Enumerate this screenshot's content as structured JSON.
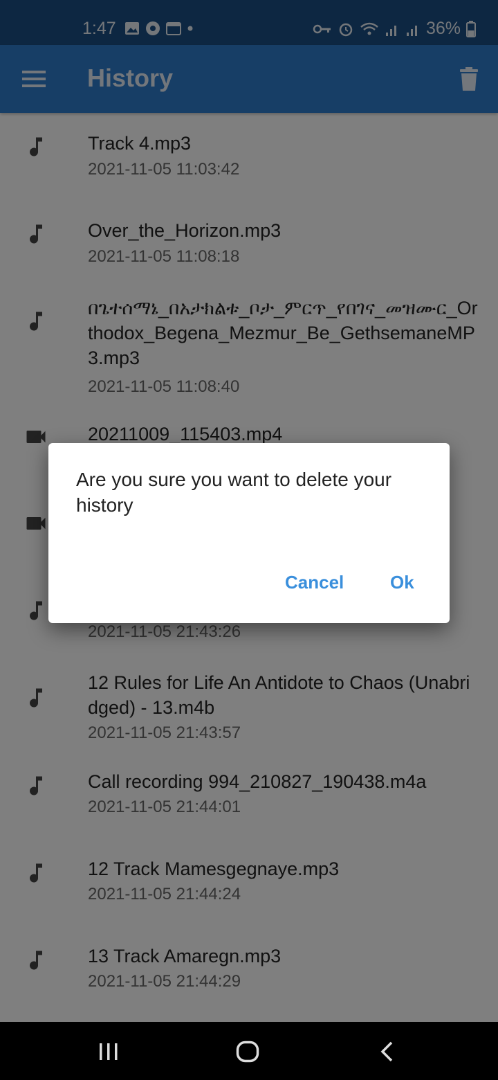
{
  "status_bar": {
    "time": "1:47",
    "battery": "36%"
  },
  "app_bar": {
    "title": "History",
    "menu_icon": "hamburger-menu-icon",
    "delete_icon": "trash-icon"
  },
  "history": [
    {
      "icon": "music-note-icon",
      "title": "Track 4.mp3",
      "date": "2021-11-05 11:03:42"
    },
    {
      "icon": "music-note-icon",
      "title": "Over_the_Horizon.mp3",
      "date": "2021-11-05 11:08:18"
    },
    {
      "icon": "music-note-icon",
      "title": "በጌተሰማኔ_በአታክልቱ_ቦታ_ምርጥ_የበገና_መዝሙር_Orthodox_Begena_Mezmur_Be_GethsemaneMP3.mp3",
      "date": "2021-11-05 11:08:40"
    },
    {
      "icon": "video-camera-icon",
      "title": "20211009_115403.mp4",
      "date": ""
    },
    {
      "icon": "video-camera-icon",
      "title": "",
      "date": ""
    },
    {
      "icon": "music-note-icon",
      "title": "",
      "date": "2021-11-05 21:43:26"
    },
    {
      "icon": "music-note-icon",
      "title": "12 Rules for Life An Antidote to Chaos (Unabridged) - 13.m4b",
      "date": "2021-11-05 21:43:57"
    },
    {
      "icon": "music-note-icon",
      "title": "Call recording 994_210827_190438.m4a",
      "date": "2021-11-05 21:44:01"
    },
    {
      "icon": "music-note-icon",
      "title": "12 Track Mamesgegnaye.mp3",
      "date": "2021-11-05 21:44:24"
    },
    {
      "icon": "music-note-icon",
      "title": "13 Track Amaregn.mp3",
      "date": "2021-11-05 21:44:29"
    }
  ],
  "dialog": {
    "message": "Are you sure you want to delete your history",
    "cancel_label": "Cancel",
    "ok_label": "Ok"
  },
  "colors": {
    "app_bar": "#2f7ccd",
    "status_bar": "#1b4f85",
    "dialog_button": "#3a8fdc"
  }
}
